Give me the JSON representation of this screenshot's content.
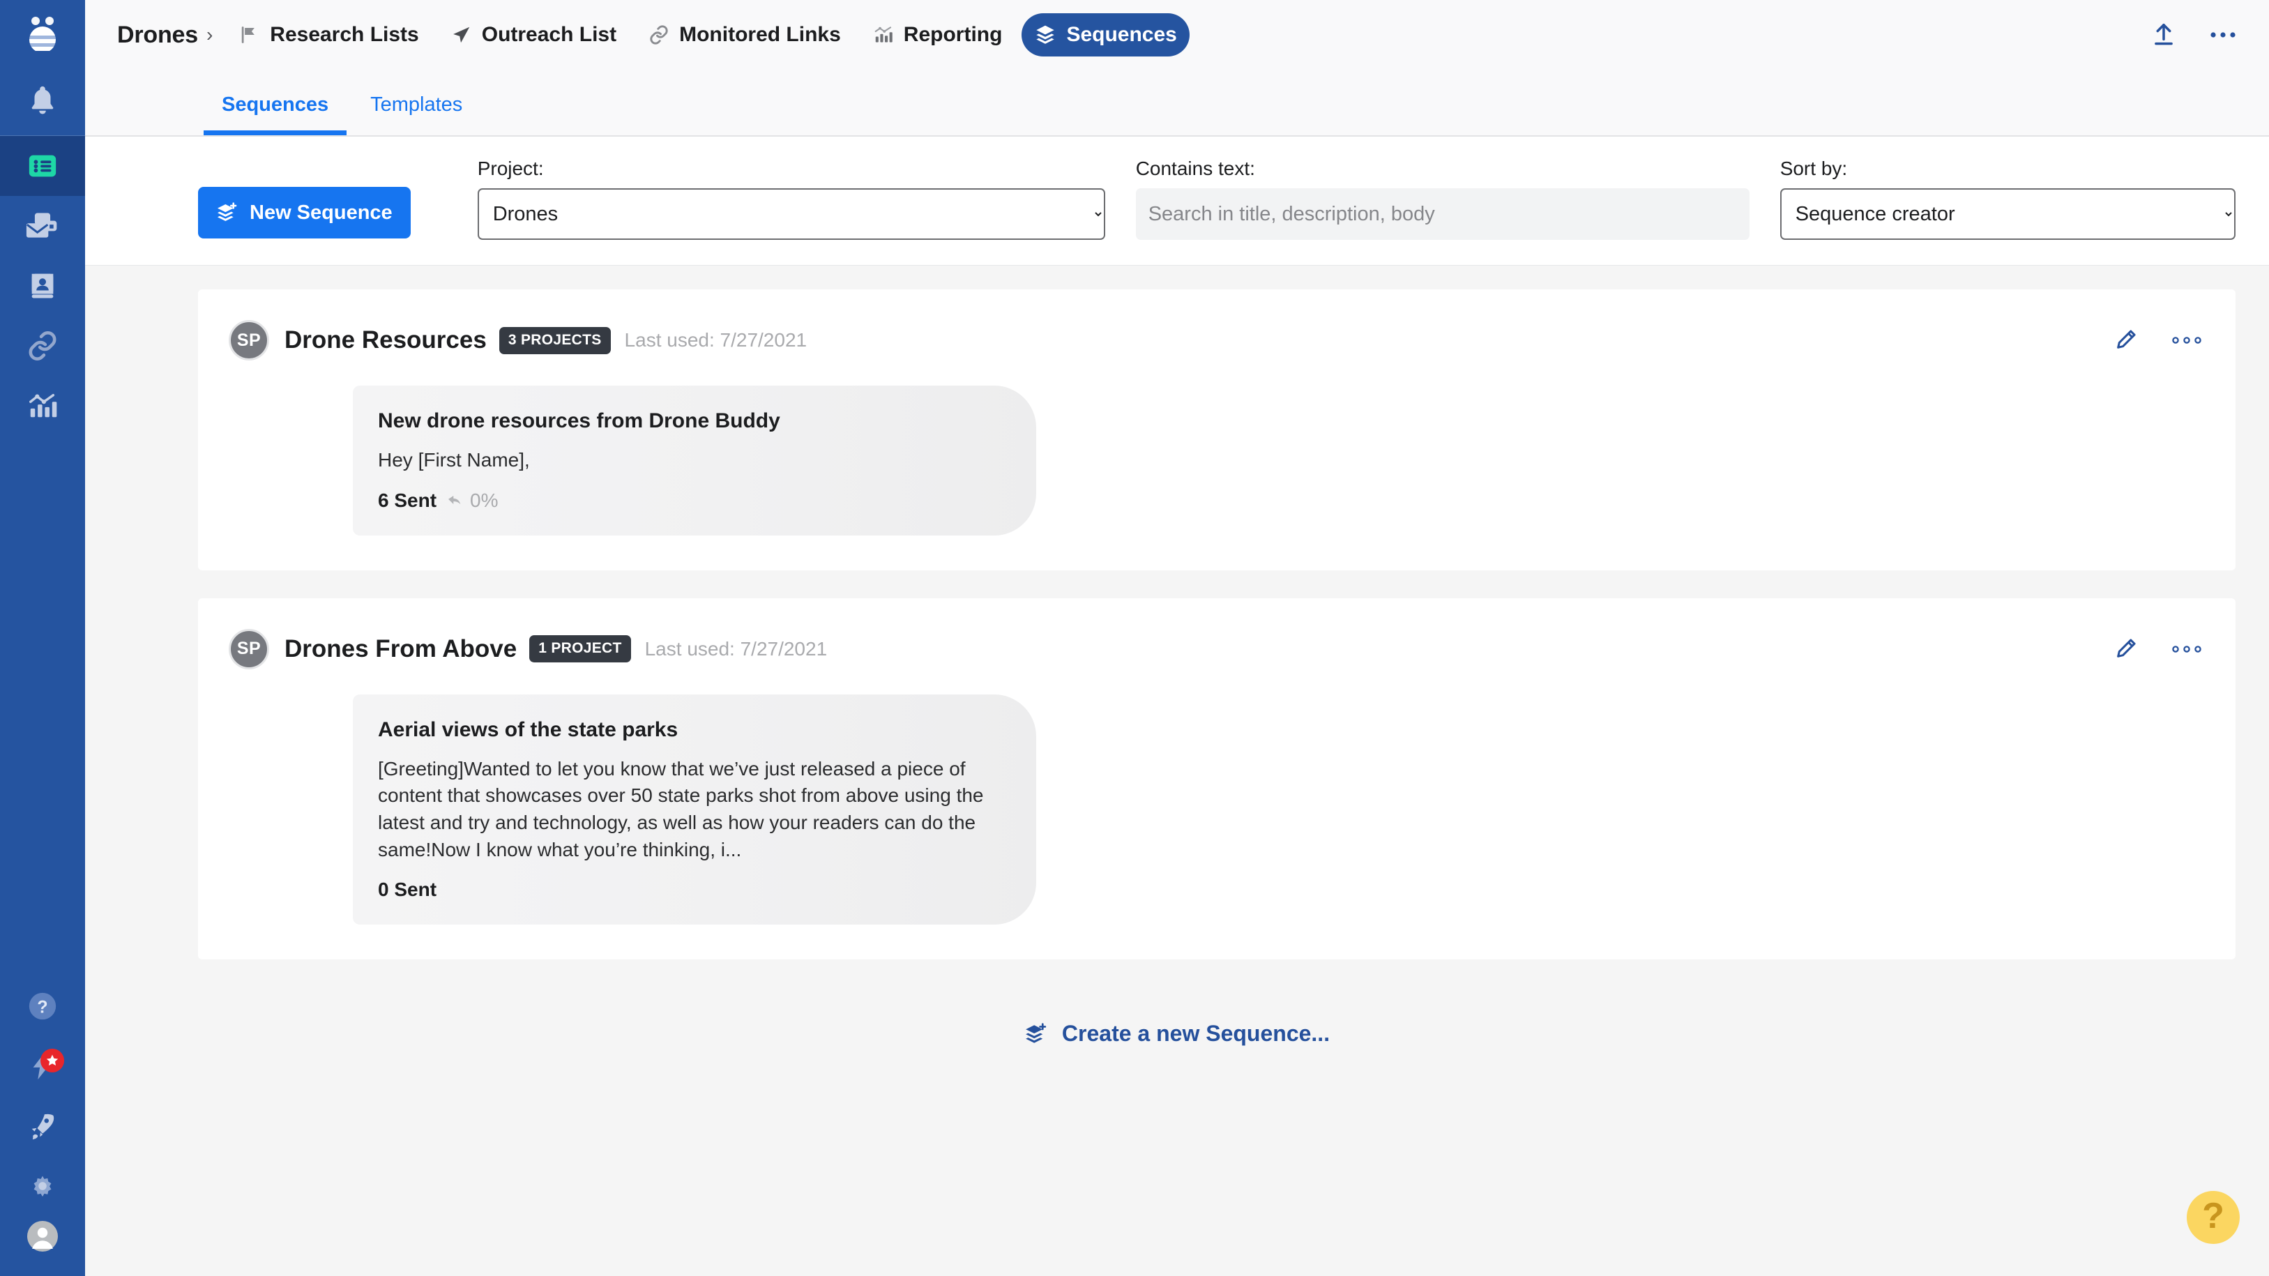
{
  "app": {
    "logo_icon": "buzzstream-logo-icon",
    "accent_blue": "#1675f0",
    "sidebar_blue": "#2554a0",
    "dark_navy": "#1b4183",
    "badge_red": "#e8262b",
    "fab_yellow": "#fbd661"
  },
  "sidebar": {
    "items": [
      {
        "name": "notifications",
        "icon": "bell-icon",
        "active": false
      },
      {
        "name": "lists",
        "icon": "list-icon",
        "active": true
      },
      {
        "name": "inbox",
        "icon": "mail-icon",
        "active": false
      },
      {
        "name": "contacts",
        "icon": "contact-book-icon",
        "active": false
      },
      {
        "name": "links",
        "icon": "link-icon",
        "active": false
      },
      {
        "name": "reporting",
        "icon": "bar-chart-icon",
        "active": false
      }
    ],
    "bottom_items": [
      {
        "name": "help",
        "icon": "question-circle-icon",
        "badge": null
      },
      {
        "name": "whats-new",
        "icon": "lightning-bolt-icon",
        "badge": "star-icon"
      },
      {
        "name": "upgrades",
        "icon": "rocket-icon",
        "badge": null
      },
      {
        "name": "settings",
        "icon": "gear-icon",
        "badge": null
      },
      {
        "name": "account",
        "icon": "user-avatar-icon",
        "badge": null
      }
    ]
  },
  "topnav": {
    "brand": "Drones",
    "caret": "›",
    "links": [
      {
        "label": "Research Lists",
        "icon": "flag-icon",
        "active": false
      },
      {
        "label": "Outreach List",
        "icon": "paper-plane-icon",
        "active": false
      },
      {
        "label": "Monitored Links",
        "icon": "link-icon",
        "active": false
      },
      {
        "label": "Reporting",
        "icon": "chart-icon",
        "active": false
      },
      {
        "label": "Sequences",
        "icon": "layers-icon",
        "active": true
      }
    ],
    "upload_icon": "upload-icon",
    "more_icon": "more-horizontal-icon"
  },
  "tabs": [
    {
      "label": "Sequences",
      "active": true
    },
    {
      "label": "Templates",
      "active": false
    }
  ],
  "filters": {
    "new_sequence_label": "New Sequence",
    "new_sequence_icon": "layers-plus-icon",
    "project": {
      "label": "Project:",
      "value": "Drones",
      "options": [
        "Drones"
      ]
    },
    "contains_text": {
      "label": "Contains text:",
      "value": "",
      "placeholder": "Search in title, description, body"
    },
    "sort_by": {
      "label": "Sort by:",
      "value": "Sequence creator",
      "options": [
        "Sequence creator"
      ]
    }
  },
  "sequences": [
    {
      "avatar_initials": "SP",
      "title": "Drone Resources",
      "projects_badge": "3 PROJECTS",
      "last_used": "Last used: 7/27/2021",
      "edit_icon": "pencil-icon",
      "menu_icon": "three-dots-icon",
      "preview": {
        "subject": "New drone resources from Drone Buddy",
        "body": "Hey [First Name],",
        "sent": "6 Sent",
        "reply_rate": "0%",
        "reply_icon": "reply-arrow-icon",
        "show_reply": true
      }
    },
    {
      "avatar_initials": "SP",
      "title": "Drones From Above",
      "projects_badge": "1 PROJECT",
      "last_used": "Last used: 7/27/2021",
      "edit_icon": "pencil-icon",
      "menu_icon": "three-dots-icon",
      "preview": {
        "subject": "Aerial views of the state parks",
        "body": "[Greeting]Wanted to let you know that we’ve just released a piece of content that showcases over 50 state parks shot from above using the latest and try and technology, as well as how your readers can do the same!Now I know what you’re thinking, i...",
        "sent": "0 Sent",
        "reply_rate": "",
        "reply_icon": "reply-arrow-icon",
        "show_reply": false
      }
    }
  ],
  "footer": {
    "create_new_label": "Create a new Sequence...",
    "create_new_icon": "layers-plus-icon"
  },
  "fab": {
    "icon": "question-mark-icon",
    "glyph": "?"
  }
}
